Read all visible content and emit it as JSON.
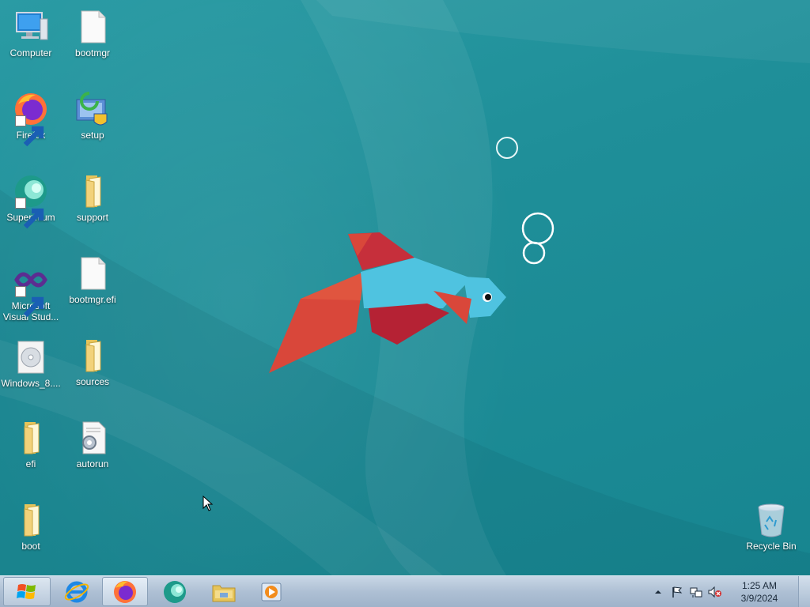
{
  "desktop": {
    "icons": [
      {
        "label": "Computer"
      },
      {
        "label": "bootmgr"
      },
      {
        "label": "Firefox"
      },
      {
        "label": "setup"
      },
      {
        "label": "Supermium"
      },
      {
        "label": "support"
      },
      {
        "label": "Microsoft Visual Stud..."
      },
      {
        "label": "bootmgr.efi"
      },
      {
        "label": "Windows_8...."
      },
      {
        "label": "sources"
      },
      {
        "label": "efi"
      },
      {
        "label": "autorun"
      },
      {
        "label": "boot"
      },
      {
        "label": "Recycle Bin"
      }
    ]
  },
  "taskbar": {
    "pinned": [
      {
        "name": "start-orb-icon"
      },
      {
        "name": "internet-explorer-icon"
      },
      {
        "name": "firefox-icon"
      },
      {
        "name": "supermium-icon"
      },
      {
        "name": "file-explorer-icon"
      },
      {
        "name": "media-player-icon"
      }
    ],
    "tray": {
      "icons": [
        "show-hidden-icons",
        "action-center-flag-icon",
        "network-icon",
        "volume-muted-icon"
      ]
    },
    "clock": {
      "time": "1:25 AM",
      "date": "3/9/2024"
    }
  },
  "colors": {
    "wallpaper": "#1f8a95",
    "taskbar": "#b3c4d8"
  }
}
